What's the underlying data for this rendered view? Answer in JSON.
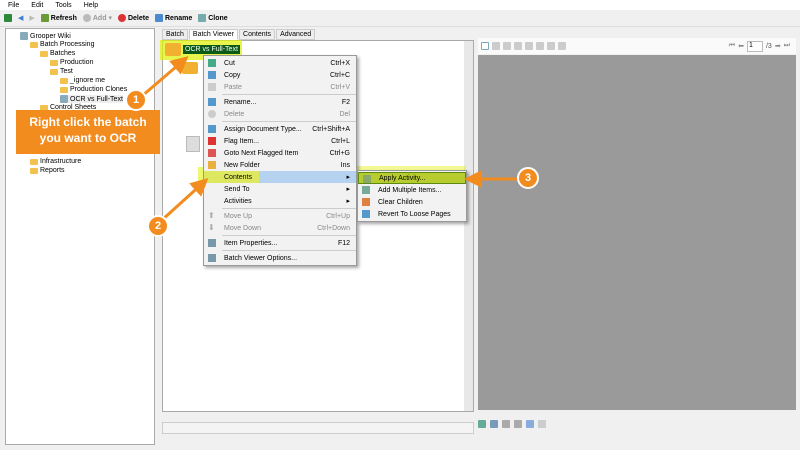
{
  "menubar": [
    "File",
    "Edit",
    "Tools",
    "Help"
  ],
  "toolbar": {
    "refresh": "Refresh",
    "add": "Add",
    "delete": "Delete",
    "rename": "Rename",
    "clone": "Clone"
  },
  "tree": [
    "Grooper Wiki",
    "Batch Processing",
    "Batches",
    "Production",
    "Test",
    "_ignore me",
    "Production Clones",
    "OCR vs Full-Text",
    "Control Sheets",
    "Infrastructure",
    "Reports"
  ],
  "tabs": [
    "Batch",
    "Batch Viewer",
    "Contents",
    "Advanced"
  ],
  "batch_node": "OCR vs Full-Text",
  "context_menu": [
    {
      "label": "Cut",
      "shortcut": "Ctrl+X"
    },
    {
      "label": "Copy",
      "shortcut": "Ctrl+C"
    },
    {
      "label": "Paste",
      "shortcut": "Ctrl+V"
    },
    {
      "label": "Rename...",
      "shortcut": "F2"
    },
    {
      "label": "Delete",
      "shortcut": "Del"
    },
    {
      "label": "Assign Document Type...",
      "shortcut": "Ctrl+Shift+A"
    },
    {
      "label": "Flag Item...",
      "shortcut": "Ctrl+L"
    },
    {
      "label": "Goto Next Flagged Item",
      "shortcut": "Ctrl+G"
    },
    {
      "label": "New Folder",
      "shortcut": "Ins"
    },
    {
      "label": "Contents",
      "shortcut": ""
    },
    {
      "label": "Send To",
      "shortcut": ""
    },
    {
      "label": "Activities",
      "shortcut": ""
    },
    {
      "label": "Move Up",
      "shortcut": "Ctrl+Up"
    },
    {
      "label": "Move Down",
      "shortcut": "Ctrl+Down"
    },
    {
      "label": "Item Properties...",
      "shortcut": "F12"
    },
    {
      "label": "Batch Viewer Options...",
      "shortcut": ""
    }
  ],
  "submenu": [
    "Apply Activity...",
    "Add Multiple Items...",
    "Clear Children",
    "Revert To Loose Pages"
  ],
  "viewer": {
    "page": "1",
    "total": "/3"
  },
  "callouts": {
    "step1_num": "1",
    "step1_text": "Right click the batch you want to OCR",
    "step2_num": "2",
    "step3_num": "3"
  },
  "colors": {
    "accent": "#f28c1e",
    "highlight": "#e0f000"
  }
}
